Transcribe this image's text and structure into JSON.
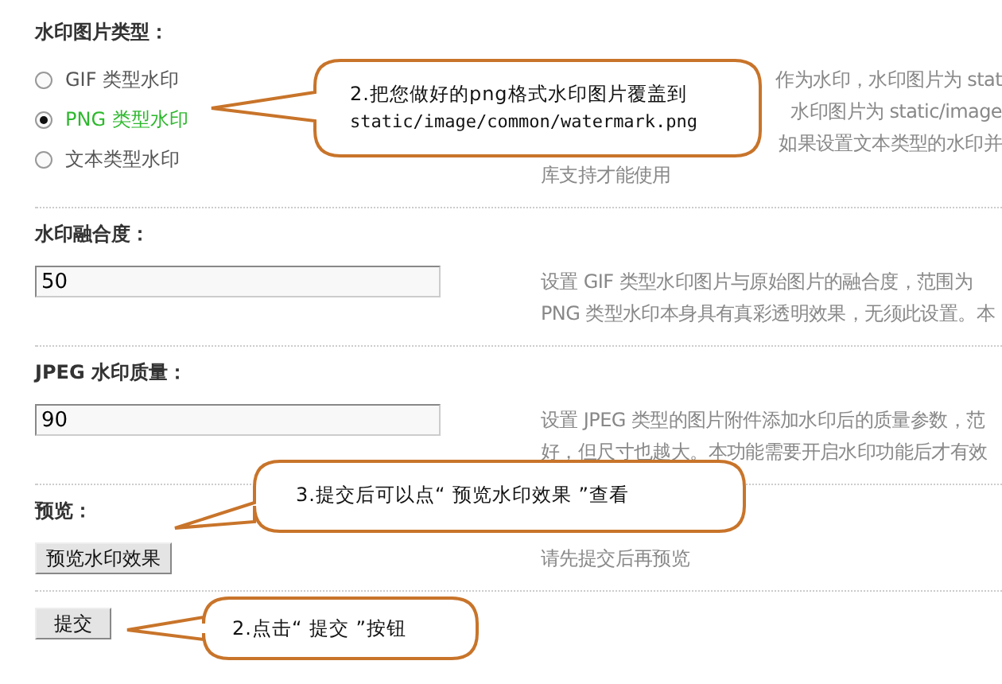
{
  "sections": [
    {
      "kind": "radio",
      "title": "水印图片类型：",
      "options": [
        {
          "label": "GIF 类型水印",
          "selected": false
        },
        {
          "label": "PNG 类型水印",
          "selected": true
        },
        {
          "label": "文本类型水印",
          "selected": false
        }
      ],
      "description": [
        "作为水印，水印图片为 stat",
        "水印图片为 static/image",
        "如果设置文本类型的水印并",
        "库支持才能使用"
      ]
    },
    {
      "kind": "input",
      "title": "水印融合度：",
      "value": "50",
      "description": [
        "设置 GIF 类型水印图片与原始图片的融合度，范围为",
        "PNG 类型水印本身具有真彩透明效果，无须此设置。本"
      ]
    },
    {
      "kind": "input",
      "title": "JPEG 水印质量：",
      "value": "90",
      "description": [
        "设置 JPEG 类型的图片附件添加水印后的质量参数，范",
        "好，但尺寸也越大。本功能需要开启水印功能后才有效"
      ]
    },
    {
      "kind": "button",
      "title": "预览：",
      "button": "预览水印效果",
      "description": [
        "请先提交后再预览"
      ]
    }
  ],
  "submit": "提交",
  "callouts": [
    {
      "lines": [
        "2.把您做好的png格式水印图片覆盖到",
        "static/image/common/watermark.png"
      ]
    },
    {
      "lines": [
        "3.提交后可以点“ 预览水印效果 ”查看"
      ]
    },
    {
      "lines": [
        "2.点击“ 提交 ”按钮"
      ]
    }
  ]
}
